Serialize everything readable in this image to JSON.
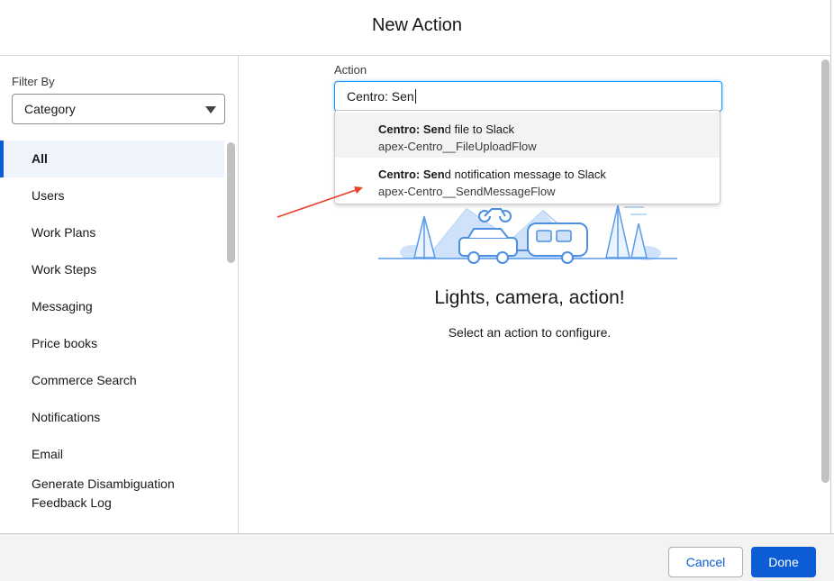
{
  "modal": {
    "title": "New Action"
  },
  "filter": {
    "label": "Filter By",
    "selected": "Category"
  },
  "categories": [
    {
      "label": "All",
      "active": true
    },
    {
      "label": "Users"
    },
    {
      "label": "Work Plans"
    },
    {
      "label": "Work Steps"
    },
    {
      "label": "Messaging"
    },
    {
      "label": "Price books"
    },
    {
      "label": "Commerce Search"
    },
    {
      "label": "Notifications"
    },
    {
      "label": "Email"
    },
    {
      "label": "Generate Disambiguation Feedback Log"
    }
  ],
  "action": {
    "label": "Action",
    "value": "Centro: Sen",
    "options": [
      {
        "match": "Centro: Sen",
        "rest": "d file to Slack",
        "api_name": "apex-Centro__FileUploadFlow"
      },
      {
        "match": "Centro: Sen",
        "rest": "d notification message to Slack",
        "api_name": "apex-Centro__SendMessageFlow"
      }
    ]
  },
  "empty_state": {
    "title": "Lights, camera, action!",
    "subtitle": "Select an action to configure."
  },
  "footer": {
    "cancel_label": "Cancel",
    "done_label": "Done"
  },
  "colors": {
    "brand": "#0b5cd5",
    "focus": "#1b96ff",
    "annotation_arrow": "#e8412c"
  },
  "icons": [
    "caret-down-icon",
    "annotation-arrow",
    "empty-state-illustration"
  ]
}
